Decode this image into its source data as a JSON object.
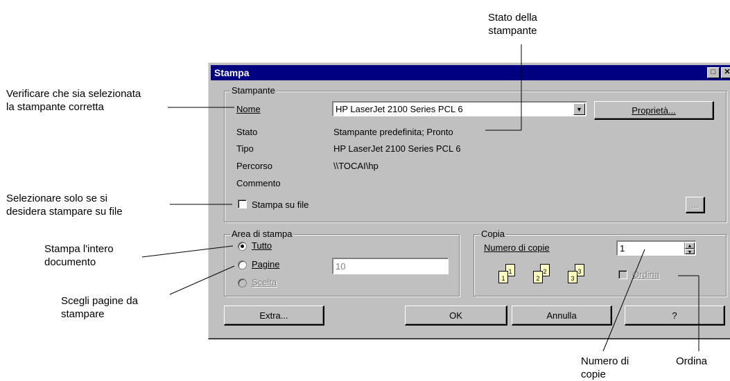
{
  "dialog": {
    "title": "Stampa",
    "title_buttons": {
      "maximize": "□",
      "close": "✕"
    }
  },
  "printer_group": {
    "legend": "Stampante",
    "name_label": "Nome",
    "name_value": "HP LaserJet 2100 Series PCL 6",
    "properties_button": "Proprietà...",
    "rows": [
      {
        "label": "Stato",
        "value": "Stampante predefinita; Pronto"
      },
      {
        "label": "Tipo",
        "value": "HP LaserJet 2100 Series PCL 6"
      },
      {
        "label": "Percorso",
        "value": "\\\\TOCAI\\hp"
      },
      {
        "label": "Commento",
        "value": ""
      }
    ],
    "print_to_file_label": "Stampa su file",
    "print_to_file_checked": false,
    "browse_button": "..."
  },
  "print_range": {
    "legend": "Area di stampa",
    "options": [
      {
        "label": "Tutto",
        "selected": true,
        "enabled": true
      },
      {
        "label": "Pagine",
        "selected": false,
        "enabled": true
      },
      {
        "label": "Scelta",
        "selected": false,
        "enabled": false
      }
    ],
    "pages_value": "10"
  },
  "copies": {
    "legend": "Copia",
    "count_label": "Numero di copie",
    "count_value": "1",
    "collate_label": "Ordina",
    "collate_checked": false,
    "collate_enabled": false,
    "collate_icon_pages": [
      "1",
      "1",
      "2",
      "2",
      "3",
      "3"
    ]
  },
  "buttons": {
    "extra": "Extra...",
    "ok": "OK",
    "cancel": "Annulla",
    "help": "?"
  },
  "callouts": {
    "printer_status": "Stato della\nstampante",
    "verify_printer": "Verificare che sia selezionata\nla stampante corretta",
    "print_to_file": "Selezionare solo se si\ndesidera stampare su file",
    "print_all": "Stampa l'intero\ndocumento",
    "choose_pages": "Scegli pagine da\nstampare",
    "num_copies": "Numero di\ncopie",
    "collate": "Ordina"
  }
}
